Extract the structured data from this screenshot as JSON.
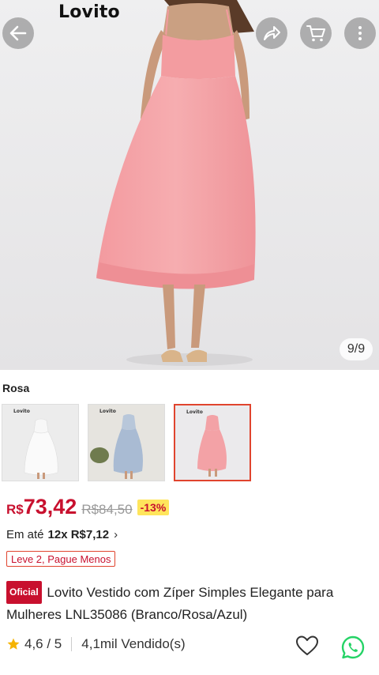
{
  "header": {
    "brand": "Lovito",
    "back_icon": "arrow-left-icon",
    "share_icon": "share-icon",
    "cart_icon": "cart-icon",
    "more_icon": "more-vertical-icon"
  },
  "gallery": {
    "counter": "9/9",
    "current_index": 9,
    "total": 9
  },
  "variant": {
    "label": "Rosa",
    "options": [
      {
        "name": "Branco",
        "color": "#f4f4f4",
        "logo": "Lovito",
        "selected": false
      },
      {
        "name": "Azul",
        "color": "#a9bbd3",
        "logo": "Lovito",
        "selected": false
      },
      {
        "name": "Rosa",
        "color": "#f3a2a2",
        "logo": "Lovito",
        "selected": true
      }
    ]
  },
  "price": {
    "currency": "R$",
    "current": "73,42",
    "original": "R$84,50",
    "discount": "-13%"
  },
  "installment": {
    "prefix": "Em até",
    "value": "12x R$7,12",
    "chevron": "›"
  },
  "promo": "Leve 2, Pague Menos",
  "product": {
    "badge": "Oficial",
    "title": "Lovito Vestido com Zíper Simples Elegante para Mulheres LNL35086 (Branco/Rosa/Azul)"
  },
  "stats": {
    "rating": "4,6 / 5",
    "sold": "4,1mil Vendido(s)"
  },
  "colors": {
    "accent": "#c8102e",
    "discount_bg": "#ffe55c",
    "star": "#f5b301",
    "whatsapp": "#25d366"
  }
}
